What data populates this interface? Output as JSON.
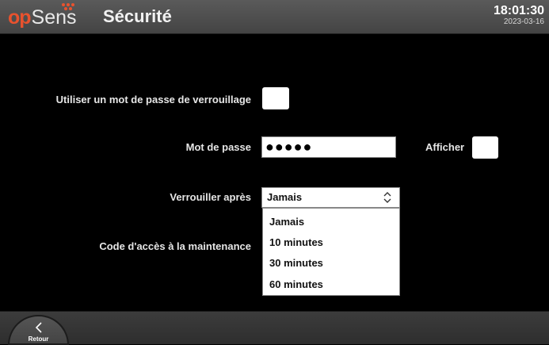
{
  "header": {
    "brand_op": "OP",
    "brand_sens": "Sens",
    "title": "Sécurité",
    "time": "18:01:30",
    "date": "2023-03-16"
  },
  "form": {
    "lock_password_label": "Utiliser un mot de passe de verrouillage",
    "password_label": "Mot de passe",
    "password_value": "●●●●●",
    "show_label": "Afficher",
    "lock_after_label": "Verrouiller après",
    "lock_after_value": "Jamais",
    "lock_after_options": [
      "Jamais",
      "10 minutes",
      "30 minutes",
      "60 minutes"
    ],
    "maintenance_code_label": "Code d'accès à la maintenance"
  },
  "footer": {
    "back_label": "Retour"
  },
  "colors": {
    "accent": "#e8522e",
    "background": "#000000",
    "header": "#4e4e4e"
  }
}
